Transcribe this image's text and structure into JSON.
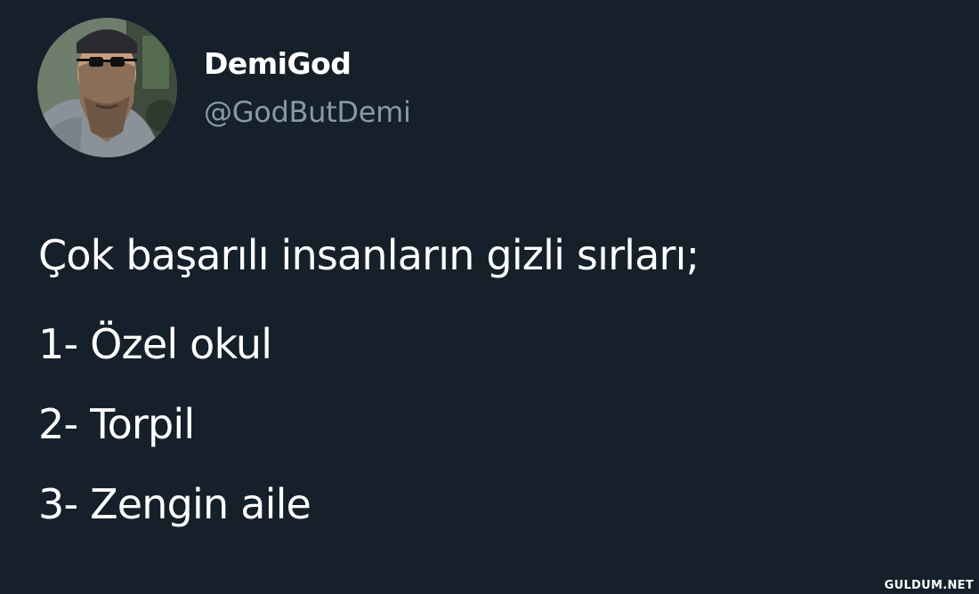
{
  "tweet": {
    "author": {
      "display_name": "DemiGod",
      "handle": "@GodButDemi",
      "avatar_icon": "user-avatar-photo"
    },
    "text": {
      "intro": "Çok başarılı insanların gizli sırları;",
      "items": [
        "1- Özel okul",
        "2- Torpil",
        "3- Zengin aile"
      ]
    }
  },
  "watermark": "GULDUM.NET",
  "colors": {
    "background": "#15202b",
    "text_primary": "#ffffff",
    "text_secondary": "#8899a6"
  }
}
